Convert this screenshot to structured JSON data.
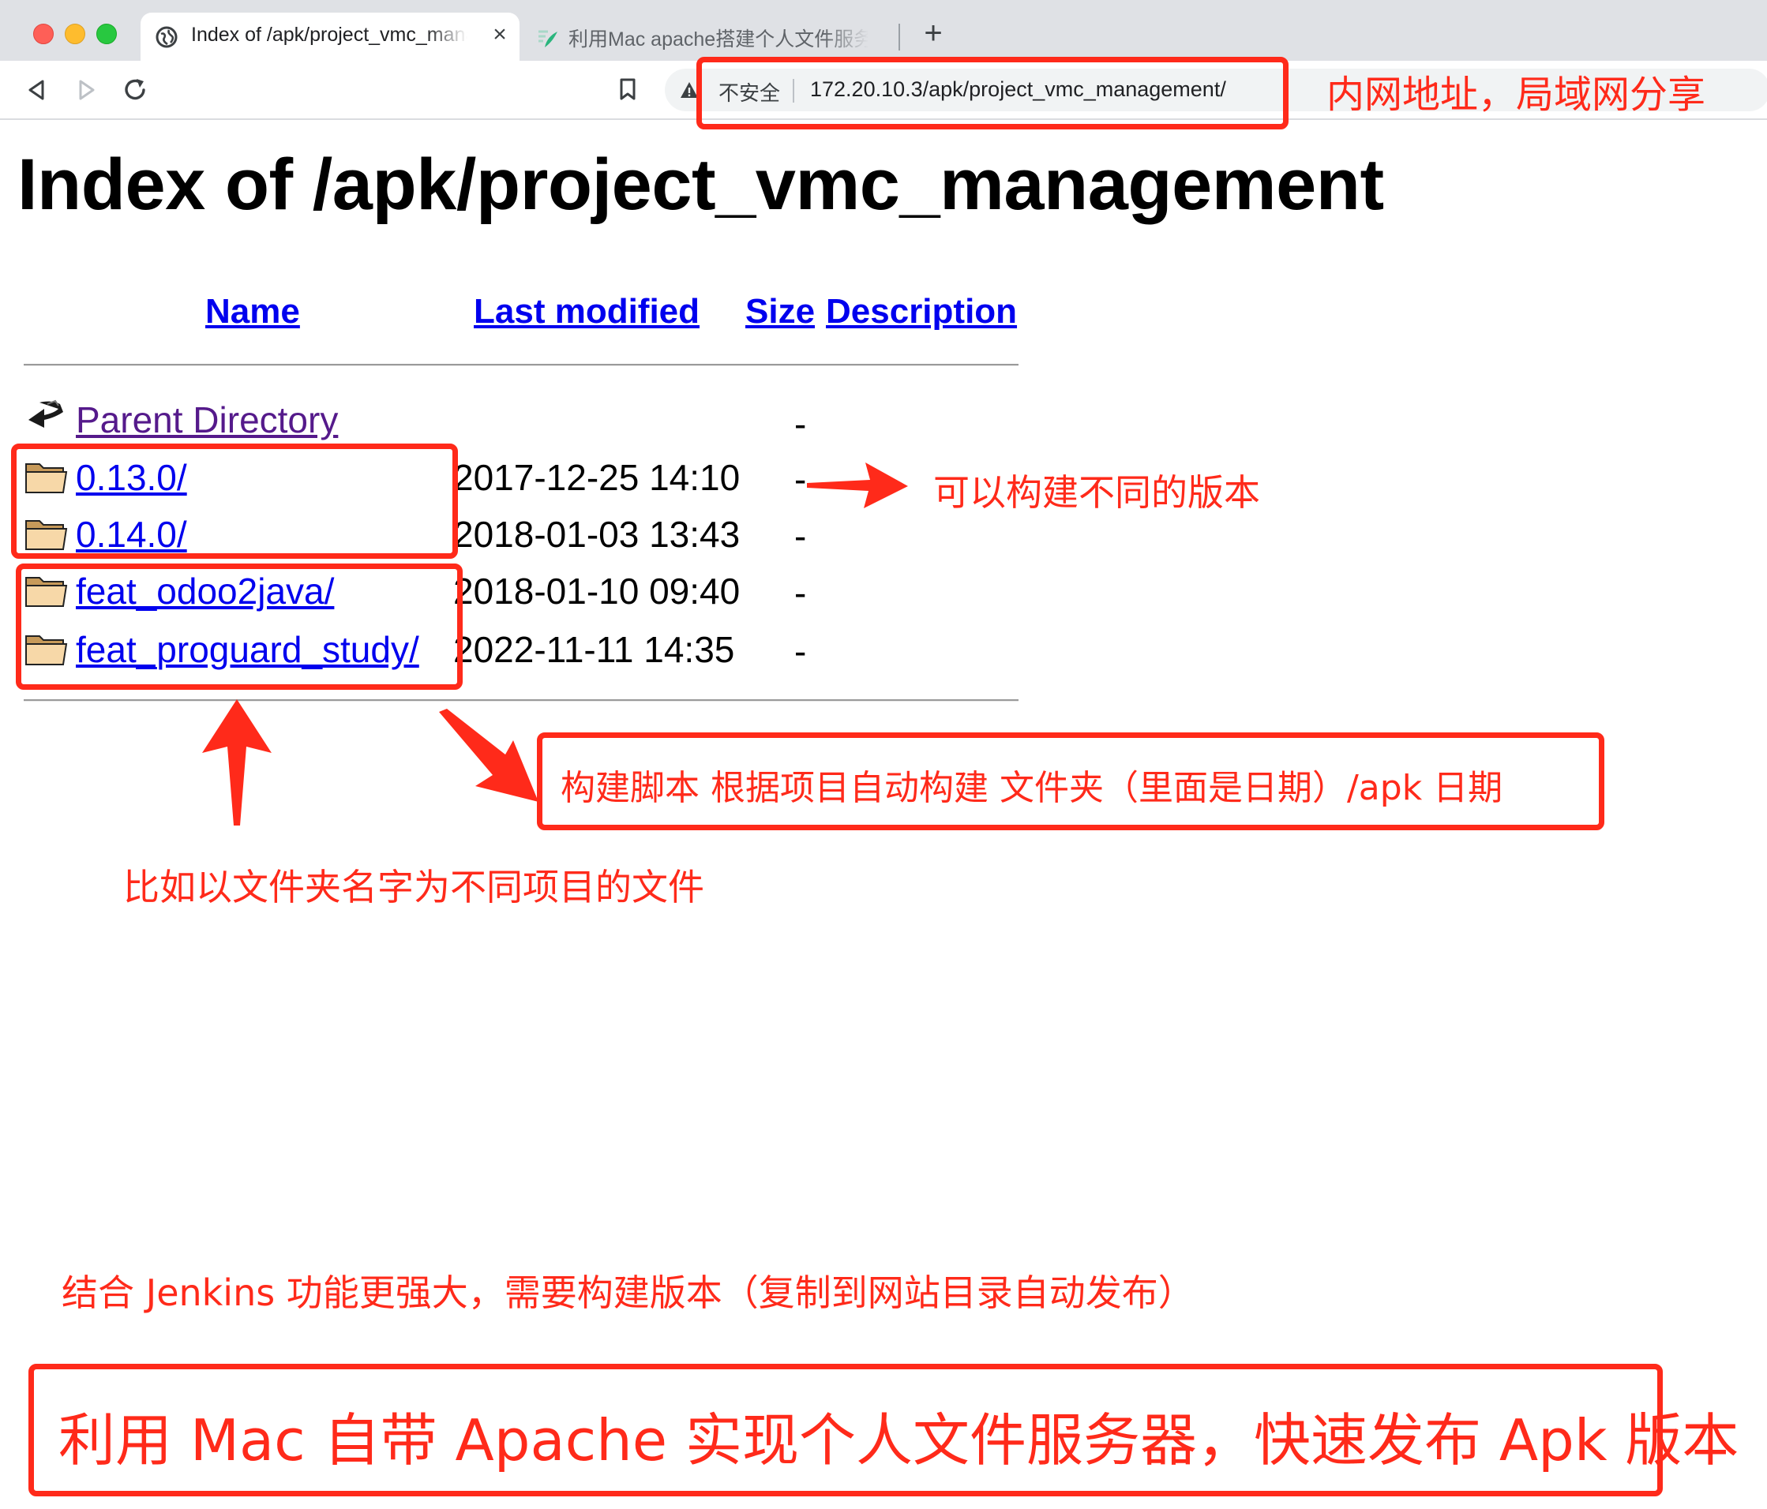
{
  "browser": {
    "tabs": [
      {
        "title": "Index of /apk/project_vmc_management",
        "active": true,
        "icon": "globe-icon"
      },
      {
        "title": "利用Mac apache搭建个人文件服务器",
        "active": false,
        "icon": "pen-leaf-icon"
      }
    ],
    "new_tab_label": "+",
    "close_label": "×",
    "security_label": "不安全",
    "url": "172.20.10.3/apk/project_vmc_management/"
  },
  "page": {
    "title": "Index of /apk/project_vmc_management",
    "columns": [
      "Name",
      "Last modified",
      "Size",
      "Description"
    ],
    "rows": [
      {
        "name": "Parent Directory",
        "modified": "",
        "size": "-",
        "icon": "back-arrow-icon"
      },
      {
        "name": "0.13.0/",
        "modified": "2017-12-25 14:10",
        "size": "-",
        "icon": "folder-icon"
      },
      {
        "name": "0.14.0/",
        "modified": "2018-01-03 13:43",
        "size": "-",
        "icon": "folder-icon"
      },
      {
        "name": "feat_odoo2java/",
        "modified": "2018-01-10 09:40",
        "size": "-",
        "icon": "folder-icon"
      },
      {
        "name": "feat_proguard_study/",
        "modified": "2022-11-11 14:35",
        "size": "-",
        "icon": "folder-icon"
      }
    ]
  },
  "annotations": {
    "lan_address": "内网地址，局域网分享",
    "versions": "可以构建不同的版本",
    "build_script": "构建脚本  根据项目自动构建 文件夹（里面是日期）/apk 日期",
    "project_folders": "比如以文件夹名字为不同项目的文件",
    "jenkins": "结合 Jenkins 功能更强大，需要构建版本（复制到网站目录自动发布）",
    "headline": "利用 Mac 自带 Apache 实现个人文件服务器，快速发布 Apk 版本"
  },
  "colors": {
    "annotation_red": "#ff2a1a",
    "link_blue": "#0000ee",
    "visited_purple": "#551a8b",
    "chrome_gray": "#dfe1e5"
  }
}
